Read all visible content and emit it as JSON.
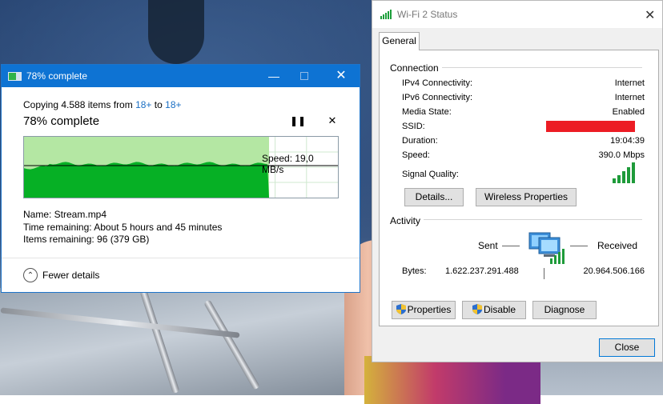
{
  "copy_dialog": {
    "title": "78% complete",
    "copying_prefix": "Copying 4.588 items from",
    "source": "18+",
    "to_word": "to",
    "destination": "18+",
    "heading": "78% complete",
    "progress_fraction": 0.78,
    "speed_label": "Speed: 19,0 MB/s",
    "name_line": "Name: Stream.mp4",
    "time_line": "Time remaining:  About 5 hours and 45 minutes",
    "items_line": "Items remaining:  96 (379 GB)",
    "fewer_details": "Fewer details",
    "close_glyph": "✕",
    "pause_glyph": "❚❚",
    "stop_glyph": "✕",
    "colors": {
      "titlebar": "#0e73d3",
      "graph_fill": "#06b025",
      "graph_progress": "#b4e7a3"
    }
  },
  "wifi_dialog": {
    "title": "Wi-Fi 2 Status",
    "close_glyph": "✕",
    "tab": "General",
    "connection": {
      "heading": "Connection",
      "rows": [
        {
          "label": "IPv4 Connectivity:",
          "value": "Internet"
        },
        {
          "label": "IPv6 Connectivity:",
          "value": "Internet"
        },
        {
          "label": "Media State:",
          "value": "Enabled"
        },
        {
          "label": "SSID:",
          "value": ""
        },
        {
          "label": "Duration:",
          "value": "19:04:39"
        },
        {
          "label": "Speed:",
          "value": "390.0 Mbps"
        }
      ],
      "signal_label": "Signal Quality:",
      "signal_bars": 5,
      "details_button": "Details...",
      "wireless_props_button": "Wireless Properties"
    },
    "activity": {
      "heading": "Activity",
      "sent_label": "Sent",
      "received_label": "Received",
      "bytes_label": "Bytes:",
      "bytes_sent": "1.622.237.291.488",
      "bytes_received": "20.964.506.166"
    },
    "properties_button": "Properties",
    "disable_button": "Disable",
    "diagnose_button": "Diagnose",
    "close_button": "Close"
  }
}
